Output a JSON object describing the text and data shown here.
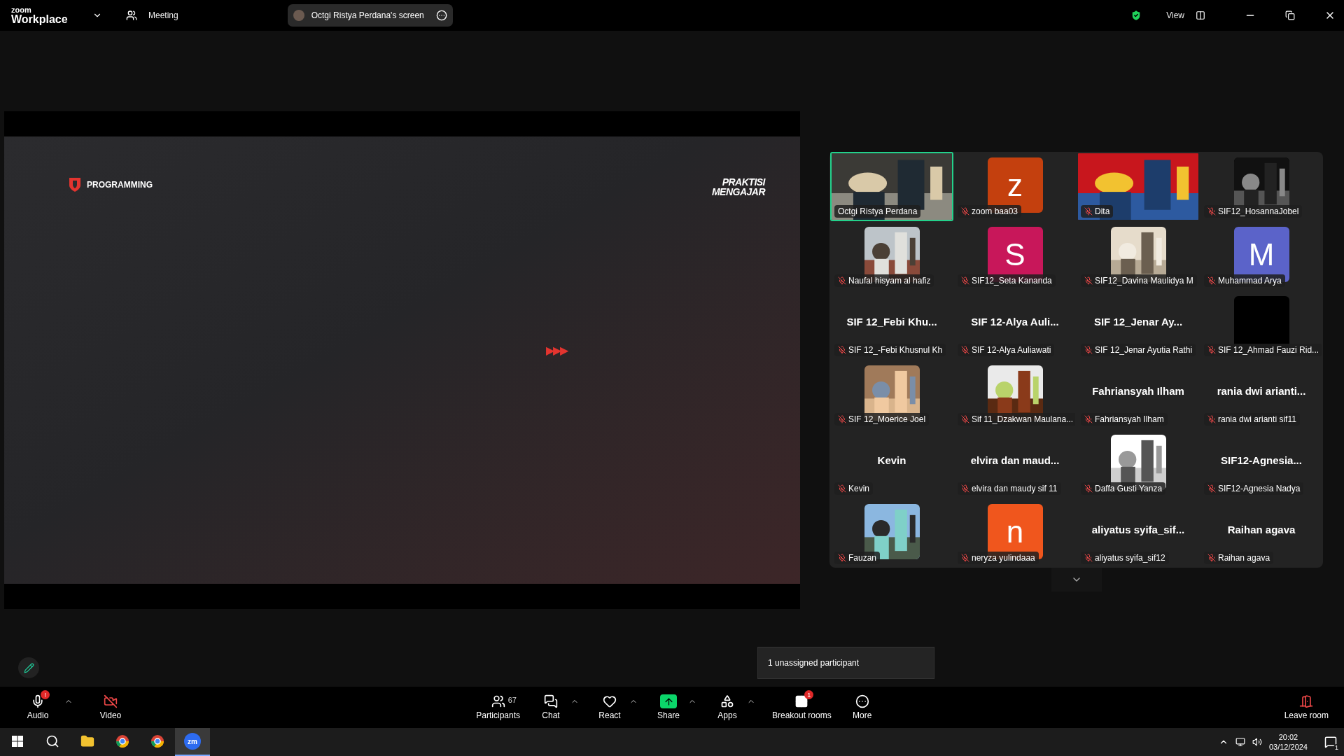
{
  "titlebar": {
    "logo_top": "zoom",
    "logo_bottom": "Workplace",
    "meeting_label": "Meeting",
    "share_pill": "Octgi Ristya Perdana's screen",
    "view_label": "View"
  },
  "slide": {
    "title": "PROGRAMMING",
    "logo_top": "PRAKTISI",
    "logo_bottom": "MENGAJAR",
    "arrows": "▶▶▶"
  },
  "tiles": [
    {
      "kind": "video",
      "label": "Octgi Ristya Perdana",
      "muted": false,
      "speaking": true
    },
    {
      "kind": "avatar",
      "letter": "z",
      "color": "#c4400e",
      "label": "zoom baa03",
      "muted": true,
      "speaking": false
    },
    {
      "kind": "video",
      "label": "Dita",
      "muted": true,
      "speaking": false
    },
    {
      "label": "SIF12_HosannaJobel",
      "muted": true,
      "speaking": false
    },
    {
      "label": "Naufal hisyam al hafiz",
      "muted": true,
      "speaking": false
    },
    {
      "kind": "avatar",
      "letter": "S",
      "color": "#c8175a",
      "label": "SIF12_Seta Kananda",
      "muted": true,
      "speaking": false
    },
    {
      "label": "SIF12_Davina Maulidya M",
      "muted": true,
      "speaking": false
    },
    {
      "kind": "avatar",
      "letter": "M",
      "color": "#5b63c9",
      "label": "Muhammad Arya",
      "muted": true,
      "speaking": false
    },
    {
      "kind": "name",
      "display_name": "SIF 12_Febi Khu...",
      "label": "SIF 12_-Febi Khusnul Kh",
      "muted": true,
      "speaking": false
    },
    {
      "kind": "name",
      "display_name": "SIF 12-Alya Auli...",
      "label": "SIF 12-Alya Auliawati",
      "muted": true,
      "speaking": false
    },
    {
      "kind": "name",
      "display_name": "SIF 12_Jenar Ay...",
      "label": "SIF 12_Jenar Ayutia Rathi",
      "muted": true,
      "speaking": false
    },
    {
      "kind": "blank",
      "label": "SIF 12_Ahmad Fauzi Rid...",
      "muted": true,
      "speaking": false
    },
    {
      "label": "SIF 12_Moerice Joel",
      "muted": true,
      "speaking": false
    },
    {
      "label": "Sif 11_Dzakwan Maulana...",
      "muted": true,
      "speaking": false
    },
    {
      "kind": "name",
      "display_name": "Fahriansyah Ilham",
      "label": "Fahriansyah Ilham",
      "muted": true,
      "speaking": false
    },
    {
      "kind": "name",
      "display_name": "rania dwi arianti...",
      "label": "rania dwi arianti sif11",
      "muted": true,
      "speaking": false
    },
    {
      "kind": "name",
      "display_name": "Kevin",
      "label": "Kevin",
      "muted": true,
      "speaking": false
    },
    {
      "kind": "name",
      "display_name": "elvira dan maud...",
      "label": "elvira dan maudy sif 11",
      "muted": true,
      "speaking": false
    },
    {
      "label": "Daffa Gusti Yanza",
      "muted": true,
      "speaking": false
    },
    {
      "kind": "name",
      "display_name": "SIF12-Agnesia...",
      "label": "SIF12-Agnesia Nadya",
      "muted": true,
      "speaking": false
    },
    {
      "label": "Fauzan",
      "muted": true,
      "speaking": false
    },
    {
      "kind": "avatar",
      "letter": "n",
      "color": "#f0561d",
      "label": "neryza yulindaaa",
      "muted": true,
      "speaking": false
    },
    {
      "kind": "name",
      "display_name": "aliyatus syifa_sif...",
      "label": "aliyatus syifa_sif12",
      "muted": true,
      "speaking": false
    },
    {
      "kind": "name",
      "display_name": "Raihan agava",
      "label": "Raihan agava",
      "muted": true,
      "speaking": false
    }
  ],
  "tooltip": "1 unassigned participant",
  "toolbar": {
    "left": [
      {
        "kind": "audio",
        "label": "Audio",
        "badge": "!",
        "caret": true,
        "off": false
      },
      {
        "kind": "video",
        "label": "Video",
        "caret": false,
        "off": true
      }
    ],
    "center": [
      {
        "kind": "participants",
        "label": "Participants",
        "count": "67",
        "caret": false
      },
      {
        "kind": "chat",
        "label": "Chat",
        "caret": true
      },
      {
        "kind": "react",
        "label": "React",
        "caret": true
      },
      {
        "kind": "share",
        "label": "Share",
        "caret": true
      },
      {
        "kind": "apps",
        "label": "Apps",
        "caret": true
      },
      {
        "kind": "breakout",
        "label": "Breakout rooms",
        "badge": "1",
        "caret": false
      },
      {
        "kind": "more",
        "label": "More",
        "caret": false
      }
    ],
    "leave": "Leave room"
  },
  "taskbar": {
    "apps": [
      {
        "kind": "explorer",
        "selected": false
      },
      {
        "kind": "chrome",
        "selected": false
      },
      {
        "kind": "chrome_profile",
        "selected": false
      },
      {
        "kind": "zoom",
        "glyph": "zm",
        "selected": true
      }
    ],
    "time": "20:02",
    "date": "03/12/2024",
    "notifications": "1"
  }
}
